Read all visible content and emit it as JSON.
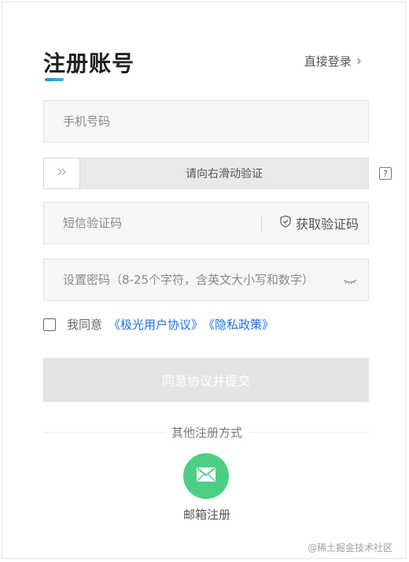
{
  "header": {
    "title": "注册账号",
    "login_link": "直接登录"
  },
  "form": {
    "phone_placeholder": "手机号码",
    "slider_text": "请向右滑动验证",
    "sms_code_placeholder": "短信验证码",
    "get_code_label": "获取验证码",
    "password_placeholder": "设置密码（8-25个字符，含英文大小写和数字）",
    "agree_prefix": "我同意",
    "agreement_link": "《极光用户协议》",
    "privacy_link": "《隐私政策》",
    "submit_label": "同意协议并提交"
  },
  "other": {
    "label": "其他注册方式",
    "email_label": "邮箱注册"
  },
  "watermark": "@稀土掘金技术社区",
  "colors": {
    "accent_gradient": [
      "#1e88e5",
      "#26c6da"
    ],
    "link": "#1a73e8",
    "email_button": "#4ccf85",
    "submit_disabled": "#e4e4e4"
  },
  "icons": {
    "login_chevron": "chevron-right-icon",
    "slider_handle": "double-chevron-right-icon",
    "help": "question-icon",
    "get_code": "shield-check-icon",
    "password_toggle": "eye-closed-icon",
    "email": "mail-icon"
  }
}
